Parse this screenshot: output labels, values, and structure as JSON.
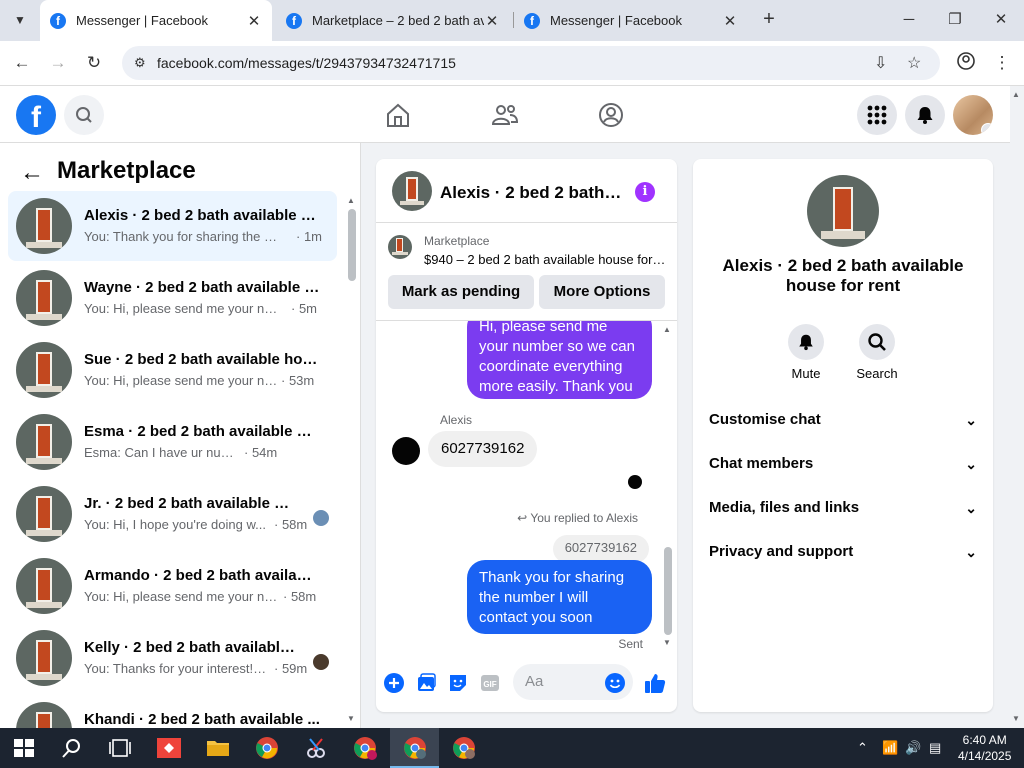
{
  "browser": {
    "tabs": [
      {
        "title": "Messenger | Facebook",
        "active": true
      },
      {
        "title": "Marketplace – 2 bed 2 bath ava",
        "active": false
      },
      {
        "title": "Messenger | Facebook",
        "active": false
      }
    ],
    "url": "facebook.com/messages/t/29437934732471715"
  },
  "sidebar": {
    "title": "Marketplace",
    "conversations": [
      {
        "name": "Alexis · 2 bed 2 bath available h...",
        "snippet": "You: Thank you for sharing the nu...",
        "time": "· 1m",
        "active": true
      },
      {
        "name": "Wayne · 2 bed 2 bath available h...",
        "snippet": "You: Hi, please send me your num...",
        "time": "· 5m"
      },
      {
        "name": "Sue · 2 bed 2 bath available hou...",
        "snippet": "You: Hi, please send me your nu...",
        "time": "· 53m"
      },
      {
        "name": "Esma · 2 bed 2 bath available ho...",
        "snippet": "Esma: Can I have ur number",
        "time": "· 54m"
      },
      {
        "name": "Jr. · 2 bed 2 bath available ho...",
        "snippet": "You: Hi, I hope you're doing w...",
        "time": "· 58m"
      },
      {
        "name": "Armando · 2 bed 2 bath availabl...",
        "snippet": "You: Hi, please send me your nu...",
        "time": "· 58m"
      },
      {
        "name": "Kelly · 2 bed 2 bath available ...",
        "snippet": "You: Thanks for your interest! T...",
        "time": "· 59m"
      },
      {
        "name": "Khandi · 2 bed 2 bath available ...",
        "snippet": "",
        "time": ""
      }
    ]
  },
  "chat": {
    "title": "Alexis · 2 bed 2 bath available house for rent",
    "listing_source": "Marketplace",
    "listing_title": "$940 – 2 bed 2 bath available house for rent",
    "mark_pending_label": "Mark as pending",
    "more_options_label": "More Options",
    "msg_out_1": "Hi, please send me your number so we can coordinate everything more easily. Thank you",
    "sender_name": "Alexis",
    "msg_in": "6027739162",
    "replied_label": "You replied to Alexis",
    "quoted_text": "6027739162",
    "msg_out_2": "Thank you for sharing the number I will contact you soon",
    "status": "Sent",
    "composer_placeholder": "Aa"
  },
  "info_panel": {
    "title": "Alexis · 2 bed 2 bath available house for rent",
    "mute_label": "Mute",
    "search_label": "Search",
    "sections": [
      "Customise chat",
      "Chat members",
      "Media, files and links",
      "Privacy and support"
    ]
  },
  "taskbar": {
    "time": "6:40 AM",
    "date": "4/14/2025"
  },
  "colors": {
    "facebook_blue": "#1877f2",
    "outgoing_purple": "#7b3cf0",
    "outgoing_blue": "#1a62f3",
    "info_purple": "#a033ff",
    "active_conversation": "#ebf5ff"
  }
}
